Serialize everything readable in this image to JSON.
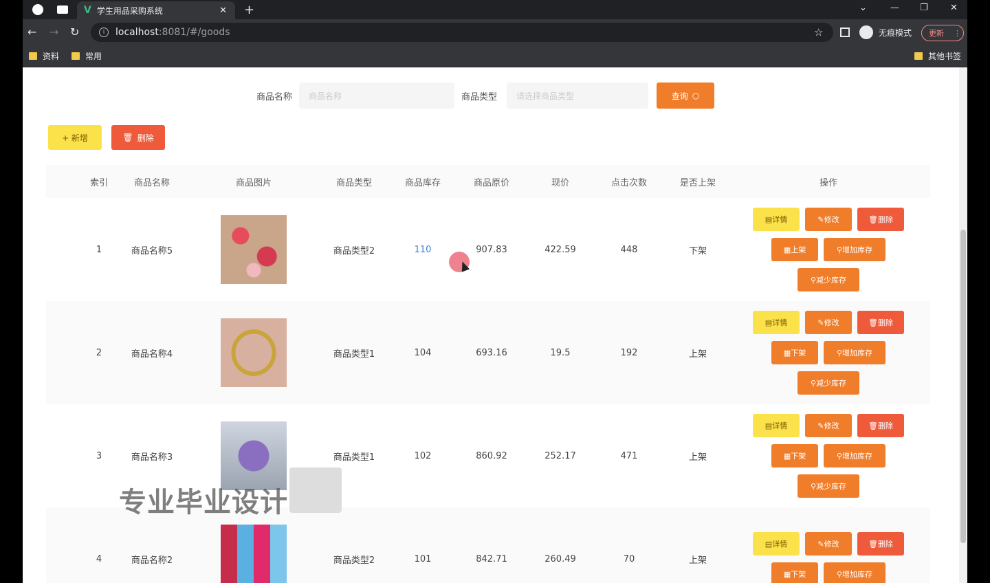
{
  "browser": {
    "tab_title": "学生用品采购系统",
    "tab_close": "✕",
    "new_tab": "+",
    "url_host": "localhost",
    "url_path": ":8081/#/goods",
    "incognito_label": "无痕模式",
    "update_label": "更新",
    "bookmarks": [
      "资料",
      "常用"
    ],
    "other_bookmarks": "其他书签"
  },
  "search": {
    "name_label": "商品名称",
    "name_placeholder": "商品名称",
    "type_label": "商品类型",
    "type_placeholder": "请选择商品类型",
    "query_label": "查询"
  },
  "actions": {
    "add_label": "+ 新增",
    "delete_label": "删除"
  },
  "table": {
    "headers": [
      "索引",
      "商品名称",
      "商品图片",
      "商品类型",
      "商品库存",
      "商品原价",
      "现价",
      "点击次数",
      "是否上架",
      "操作"
    ],
    "rows": [
      {
        "index": "1",
        "name": "商品名称5",
        "type": "商品类型2",
        "stock": "110",
        "original_price": "907.83",
        "price": "422.59",
        "clicks": "448",
        "status": "下架",
        "shelf_action": "上架"
      },
      {
        "index": "2",
        "name": "商品名称4",
        "type": "商品类型1",
        "stock": "104",
        "original_price": "693.16",
        "price": "19.5",
        "clicks": "192",
        "status": "上架",
        "shelf_action": "下架"
      },
      {
        "index": "3",
        "name": "商品名称3",
        "type": "商品类型1",
        "stock": "102",
        "original_price": "860.92",
        "price": "252.17",
        "clicks": "471",
        "status": "上架",
        "shelf_action": "下架"
      },
      {
        "index": "4",
        "name": "商品名称2",
        "type": "商品类型2",
        "stock": "101",
        "original_price": "842.71",
        "price": "260.49",
        "clicks": "70",
        "status": "上架",
        "shelf_action": "下架"
      }
    ],
    "op_labels": {
      "detail": "详情",
      "edit": "修改",
      "delete": "删除",
      "increase_stock": "增加库存",
      "decrease_stock": "减少库存"
    }
  },
  "overlay": {
    "watermark": "专业毕业设计"
  }
}
